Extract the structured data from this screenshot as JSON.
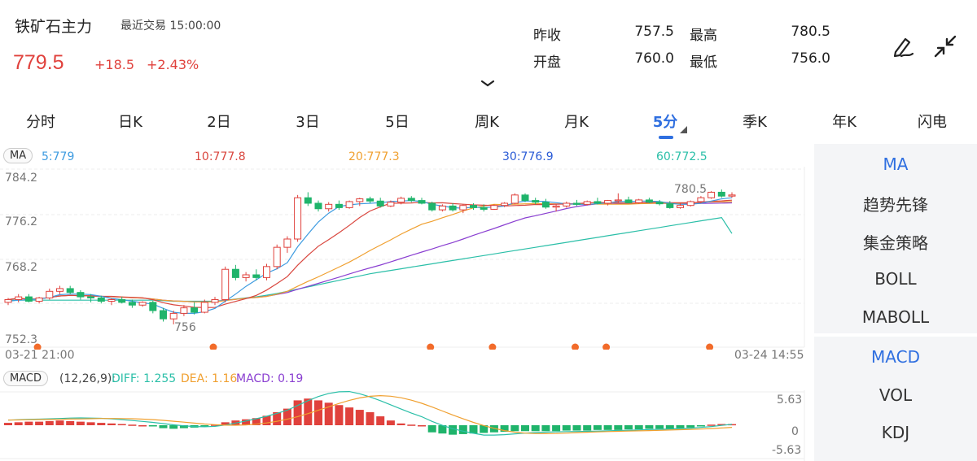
{
  "header": {
    "title": "铁矿石主力",
    "last_trade_label": "最近交易",
    "last_trade_time": "15:00:00",
    "price": "779.5",
    "change": "+18.5",
    "change_pct": "+2.43%"
  },
  "quote": {
    "prev_close_label": "昨收",
    "prev_close": "757.5",
    "high_label": "最高",
    "high": "780.5",
    "open_label": "开盘",
    "open": "760.0",
    "low_label": "最低",
    "low": "756.0"
  },
  "icons": {
    "draw": "pen-draw-icon",
    "collapse": "collapse-arrows-icon",
    "expand": "chevron-down-icon"
  },
  "tabs": [
    "分时",
    "日K",
    "2日",
    "3日",
    "5日",
    "周K",
    "月K",
    "5分",
    "季K",
    "年K",
    "闪电"
  ],
  "active_tab": "5分",
  "ma_legend": {
    "label": "MA",
    "ma5": "5:779",
    "ma10": "10:777.8",
    "ma20": "20:777.3",
    "ma30": "30:776.9",
    "ma60": "60:772.5"
  },
  "colors": {
    "up": "#e0413c",
    "down": "#1fb46b",
    "ma5": "#3d9be0",
    "ma10": "#d9463e",
    "ma20": "#f0a030",
    "ma30": "#8a3fd1",
    "ma60": "#2bbfa8",
    "active": "#2f6fe0"
  },
  "price_axis": {
    "ticks": [
      "784.2",
      "776.2",
      "768.2",
      "752.3"
    ]
  },
  "time_axis": {
    "start": "03-21 21:00",
    "end": "03-24 14:55"
  },
  "annotations": {
    "high_mark": "780.5",
    "low_mark": "756"
  },
  "macd_legend": {
    "label": "MACD",
    "params": "(12,26,9):",
    "diff": "DIFF: 1.255",
    "dea": "DEA: 1.16",
    "macd": "MACD: 0.19"
  },
  "macd_axis": {
    "top": "5.63",
    "mid": "0",
    "bottom": "-5.63"
  },
  "sidebar": {
    "main": [
      "MA",
      "趋势先锋",
      "集金策略",
      "BOLL",
      "MABOLL"
    ],
    "sub": [
      "MACD",
      "VOL",
      "KDJ"
    ]
  },
  "chart_data": {
    "type": "candlestick",
    "price_range": [
      752.3,
      784.2
    ],
    "candles": [
      [
        760.0,
        760.8,
        759.5,
        760.5
      ],
      [
        760.5,
        761.5,
        760.0,
        761.0
      ],
      [
        761.0,
        761.5,
        760.0,
        760.2
      ],
      [
        760.2,
        761.0,
        759.8,
        760.8
      ],
      [
        760.8,
        762.5,
        760.5,
        762.0
      ],
      [
        762.0,
        763.0,
        761.5,
        762.5
      ],
      [
        762.5,
        763.0,
        761.5,
        761.8
      ],
      [
        761.8,
        762.2,
        760.5,
        761.0
      ],
      [
        761.0,
        761.5,
        760.0,
        760.8
      ],
      [
        760.8,
        761.2,
        759.8,
        760.2
      ],
      [
        760.2,
        760.8,
        759.5,
        760.5
      ],
      [
        760.5,
        761.0,
        759.8,
        760.0
      ],
      [
        760.0,
        760.5,
        759.0,
        759.5
      ],
      [
        759.5,
        760.2,
        759.2,
        760.0
      ],
      [
        760.0,
        760.3,
        758.0,
        758.5
      ],
      [
        758.5,
        759.0,
        756.5,
        757.0
      ],
      [
        757.0,
        758.5,
        756.0,
        758.0
      ],
      [
        758.0,
        759.5,
        757.5,
        759.0
      ],
      [
        759.0,
        760.0,
        757.8,
        758.2
      ],
      [
        758.2,
        760.5,
        758.0,
        760.0
      ],
      [
        760.0,
        761.0,
        759.5,
        760.5
      ],
      [
        760.5,
        766.5,
        760.0,
        766.0
      ],
      [
        766.0,
        766.8,
        764.0,
        764.5
      ],
      [
        764.5,
        765.5,
        763.8,
        765.0
      ],
      [
        765.0,
        766.0,
        764.0,
        764.5
      ],
      [
        764.5,
        767.0,
        764.0,
        766.5
      ],
      [
        766.5,
        770.5,
        766.0,
        770.0
      ],
      [
        770.0,
        772.0,
        769.0,
        771.5
      ],
      [
        771.5,
        779.5,
        771.0,
        779.0
      ],
      [
        779.0,
        780.0,
        777.5,
        778.0
      ],
      [
        778.0,
        778.5,
        776.5,
        777.0
      ],
      [
        777.0,
        778.2,
        776.5,
        777.8
      ],
      [
        777.8,
        778.5,
        776.8,
        777.2
      ],
      [
        777.2,
        778.5,
        777.0,
        778.3
      ],
      [
        778.3,
        779.0,
        777.5,
        778.8
      ],
      [
        778.8,
        779.2,
        778.0,
        778.4
      ],
      [
        778.4,
        779.0,
        777.2,
        777.5
      ],
      [
        777.5,
        778.5,
        777.3,
        778.2
      ],
      [
        778.2,
        779.2,
        777.8,
        778.9
      ],
      [
        778.9,
        779.3,
        778.2,
        778.5
      ],
      [
        778.5,
        779.0,
        777.8,
        778.0
      ],
      [
        778.0,
        778.3,
        776.5,
        776.8
      ],
      [
        776.8,
        777.8,
        776.5,
        777.5
      ],
      [
        777.5,
        778.0,
        776.5,
        776.8
      ],
      [
        776.8,
        777.8,
        776.2,
        777.6
      ],
      [
        777.6,
        778.0,
        776.8,
        777.2
      ],
      [
        777.2,
        777.8,
        776.5,
        776.9
      ],
      [
        776.9,
        777.8,
        776.8,
        777.6
      ],
      [
        777.6,
        778.2,
        777.3,
        778.0
      ],
      [
        778.0,
        779.8,
        777.8,
        779.5
      ],
      [
        779.5,
        779.8,
        778.2,
        778.5
      ],
      [
        778.5,
        779.0,
        777.8,
        778.2
      ],
      [
        778.2,
        778.8,
        777.0,
        777.3
      ],
      [
        777.3,
        777.8,
        776.5,
        777.5
      ],
      [
        777.5,
        778.3,
        777.2,
        778.0
      ],
      [
        778.0,
        778.6,
        777.5,
        777.8
      ],
      [
        777.8,
        778.5,
        777.6,
        778.3
      ],
      [
        778.3,
        779.0,
        777.8,
        778.0
      ],
      [
        778.0,
        778.6,
        777.6,
        778.5
      ],
      [
        778.5,
        779.8,
        778.0,
        778.6
      ],
      [
        778.6,
        779.2,
        778.0,
        778.1
      ],
      [
        778.1,
        778.8,
        777.9,
        778.6
      ],
      [
        778.6,
        779.0,
        778.0,
        778.2
      ],
      [
        778.2,
        778.6,
        777.6,
        777.9
      ],
      [
        777.9,
        778.4,
        777.0,
        777.2
      ],
      [
        777.2,
        778.0,
        777.0,
        777.6
      ],
      [
        777.6,
        778.5,
        777.4,
        778.3
      ],
      [
        778.3,
        779.3,
        778.0,
        779.0
      ],
      [
        779.0,
        780.2,
        778.8,
        780.0
      ],
      [
        780.0,
        780.5,
        779.0,
        779.3
      ],
      [
        779.3,
        780.0,
        779.0,
        779.5
      ]
    ],
    "ma5": [
      760.2,
      760.4,
      760.5,
      760.6,
      760.9,
      761.4,
      761.5,
      761.5,
      761.4,
      761.1,
      760.7,
      760.5,
      760.2,
      759.9,
      759.7,
      758.9,
      758.2,
      758.0,
      758.0,
      758.3,
      758.9,
      760.2,
      761.5,
      762.9,
      764.1,
      765.3,
      766.1,
      767.2,
      770.1,
      772.4,
      774.6,
      776.2,
      777.4,
      777.7,
      777.9,
      778.0,
      778.1,
      778.3,
      778.4,
      778.5,
      778.3,
      777.8,
      777.5,
      777.2,
      777.1,
      777.3,
      777.2,
      777.3,
      777.5,
      778.1,
      778.4,
      778.4,
      778.3,
      778.1,
      777.9,
      777.8,
      777.8,
      777.9,
      778.1,
      778.3,
      778.3,
      778.4,
      778.4,
      778.3,
      778.0,
      777.8,
      777.8,
      778.0,
      778.4,
      778.8,
      779.0
    ],
    "ma60": [
      760.4,
      760.4,
      760.4,
      760.4,
      760.4,
      760.4,
      760.4,
      760.4,
      760.4,
      760.4,
      760.4,
      760.4,
      760.4,
      760.4,
      760.4,
      760.3,
      760.2,
      760.2,
      760.2,
      760.2,
      760.2,
      760.4,
      760.6,
      760.8,
      761.0,
      761.3,
      761.6,
      762.0,
      762.4,
      762.8,
      763.2,
      763.6,
      764.0,
      764.4,
      764.8,
      765.2,
      765.5,
      765.8,
      766.1,
      766.4,
      766.7,
      767.0,
      767.3,
      767.6,
      767.9,
      768.2,
      768.5,
      768.8,
      769.1,
      769.4,
      769.7,
      770.0,
      770.3,
      770.6,
      770.9,
      771.2,
      771.5,
      771.8,
      772.1,
      772.4,
      772.7,
      773.0,
      773.3,
      773.6,
      773.9,
      774.2,
      774.5,
      774.8,
      775.1,
      775.4,
      772.5
    ],
    "macd": [
      0.4,
      0.5,
      0.6,
      0.6,
      0.7,
      0.8,
      0.7,
      0.6,
      0.5,
      0.4,
      0.3,
      0.2,
      0.1,
      0.0,
      -0.2,
      -0.5,
      -0.6,
      -0.5,
      -0.4,
      -0.2,
      0.1,
      0.5,
      0.8,
      1.0,
      1.2,
      1.6,
      2.2,
      2.8,
      4.2,
      4.5,
      4.2,
      3.8,
      3.4,
      3.0,
      2.6,
      2.2,
      1.5,
      0.8,
      0.3,
      0.1,
      0.0,
      -1.2,
      -1.4,
      -1.6,
      -1.5,
      -1.4,
      -1.3,
      -1.2,
      -1.1,
      -1.0,
      -1.0,
      -1.0,
      -1.0,
      -1.0,
      -0.9,
      -0.9,
      -0.9,
      -0.8,
      -0.8,
      -0.8,
      -0.7,
      -0.7,
      -0.6,
      -0.6,
      -0.6,
      -0.5,
      -0.4,
      -0.2,
      0.1,
      0.2,
      0.19
    ],
    "macd_range": [
      -5.63,
      5.63
    ]
  }
}
